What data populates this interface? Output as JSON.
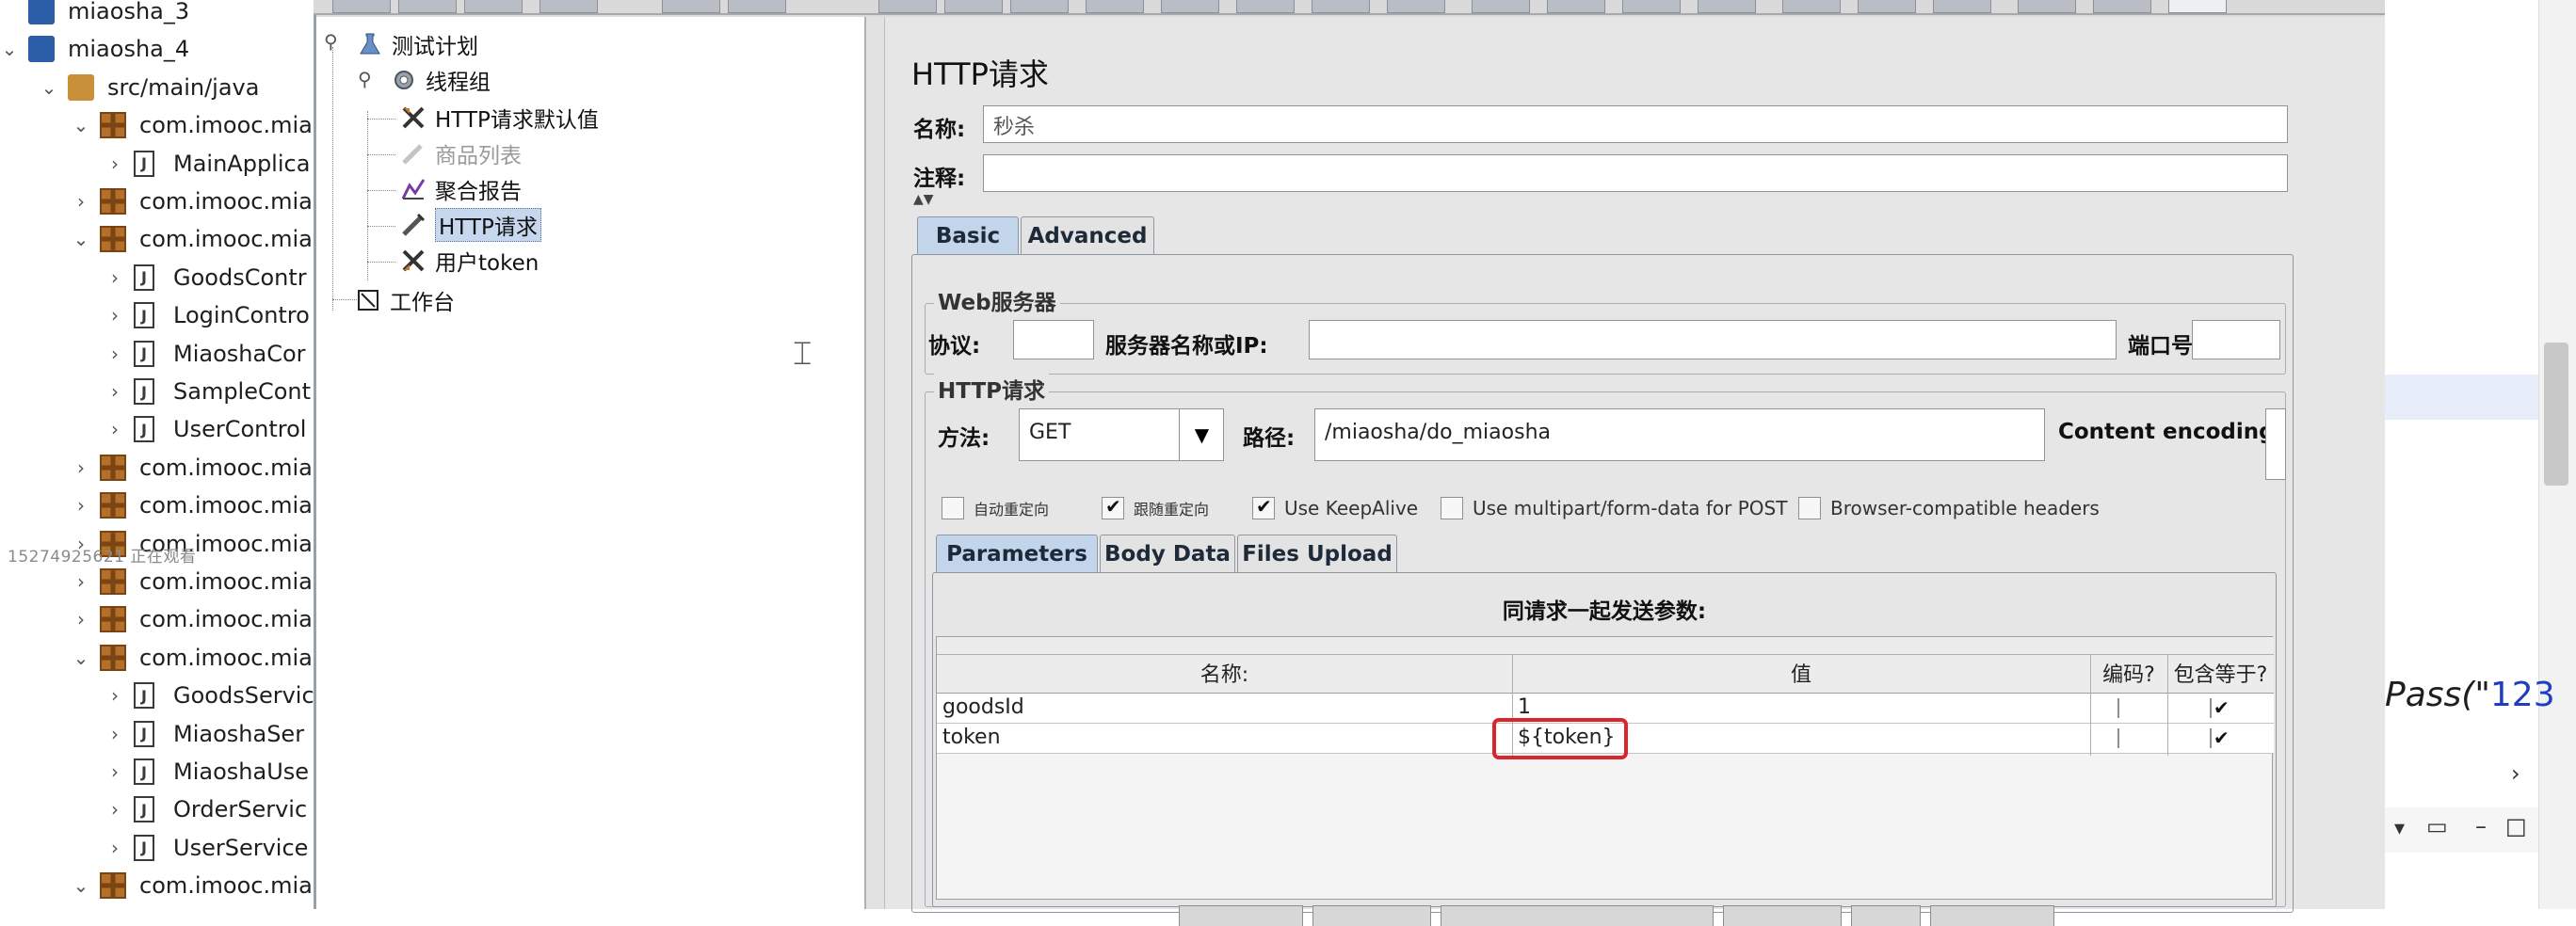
{
  "ide": {
    "tree": [
      {
        "label": "miaosha_3",
        "indent": 0,
        "icon": "project",
        "expanded": null
      },
      {
        "label": "miaosha_4",
        "indent": 0,
        "icon": "project",
        "expanded": true
      },
      {
        "label": "src/main/java",
        "indent": 1,
        "icon": "source-folder",
        "expanded": true
      },
      {
        "label": "com.imooc.mia",
        "indent": 2,
        "icon": "package",
        "expanded": true
      },
      {
        "label": "MainApplica",
        "indent": 3,
        "icon": "java",
        "expanded": false
      },
      {
        "label": "com.imooc.mia",
        "indent": 2,
        "icon": "package",
        "expanded": false
      },
      {
        "label": "com.imooc.mia",
        "indent": 2,
        "icon": "package",
        "expanded": true
      },
      {
        "label": "GoodsContr",
        "indent": 3,
        "icon": "java",
        "expanded": false
      },
      {
        "label": "LoginContro",
        "indent": 3,
        "icon": "java",
        "expanded": false
      },
      {
        "label": "MiaoshaCor",
        "indent": 3,
        "icon": "java",
        "expanded": false
      },
      {
        "label": "SampleCont",
        "indent": 3,
        "icon": "java",
        "expanded": false
      },
      {
        "label": "UserControl",
        "indent": 3,
        "icon": "java",
        "expanded": false
      },
      {
        "label": "com.imooc.mia",
        "indent": 2,
        "icon": "package",
        "expanded": false
      },
      {
        "label": "com.imooc.mia",
        "indent": 2,
        "icon": "package",
        "expanded": false
      },
      {
        "label": "com.imooc.mia",
        "indent": 2,
        "icon": "package",
        "expanded": false
      },
      {
        "label": "com.imooc.mia",
        "indent": 2,
        "icon": "package",
        "expanded": false
      },
      {
        "label": "com.imooc.mia",
        "indent": 2,
        "icon": "package",
        "expanded": false
      },
      {
        "label": "com.imooc.mia",
        "indent": 2,
        "icon": "package",
        "expanded": true
      },
      {
        "label": "GoodsServic",
        "indent": 3,
        "icon": "java",
        "expanded": false
      },
      {
        "label": "MiaoshaSer",
        "indent": 3,
        "icon": "java",
        "expanded": false
      },
      {
        "label": "MiaoshaUse",
        "indent": 3,
        "icon": "java",
        "expanded": false
      },
      {
        "label": "OrderServic",
        "indent": 3,
        "icon": "java",
        "expanded": false
      },
      {
        "label": "UserService",
        "indent": 3,
        "icon": "java",
        "expanded": false
      },
      {
        "label": "com.imooc.mia",
        "indent": 2,
        "icon": "package",
        "expanded": true
      }
    ],
    "watermark": "15274925621 正在观看"
  },
  "jmeter": {
    "tree": {
      "test_plan": "测试计划",
      "thread_group": "线程组",
      "http_defaults": "HTTP请求默认值",
      "goods_list": "商品列表",
      "aggregate_report": "聚合报告",
      "http_request": "HTTP请求",
      "user_token": "用户token",
      "workbench": "工作台"
    },
    "panel": {
      "title": "HTTP请求",
      "name_label": "名称:",
      "name_value": "秒杀",
      "comment_label": "注释:",
      "comment_value": "",
      "tabs": [
        "Basic",
        "Advanced"
      ],
      "web_server": {
        "title": "Web服务器",
        "protocol_label": "协议:",
        "server_label": "服务器名称或IP:",
        "port_label": "端口号:"
      },
      "http_section": {
        "title": "HTTP请求",
        "method_label": "方法:",
        "method_value": "GET",
        "path_label": "路径:",
        "path_value": "/miaosha/do_miaosha",
        "encoding_label": "Content encoding:"
      },
      "options": [
        {
          "label": "自动重定向",
          "checked": false
        },
        {
          "label": "跟随重定向",
          "checked": true
        },
        {
          "label": "Use KeepAlive",
          "checked": true
        },
        {
          "label": "Use multipart/form-data for POST",
          "checked": false
        },
        {
          "label": "Browser-compatible headers",
          "checked": false
        }
      ],
      "param_tabs": [
        "Parameters",
        "Body Data",
        "Files Upload"
      ],
      "params_title": "同请求一起发送参数:",
      "columns": [
        "名称:",
        "值",
        "编码?",
        "包含等于?"
      ],
      "rows": [
        {
          "name": "goodsId",
          "value": "1",
          "encode": false,
          "include_equals": true
        },
        {
          "name": "token",
          "value": "${token}",
          "encode": false,
          "include_equals": true
        }
      ]
    }
  },
  "editor": {
    "code_fragment_1": "Pass(\"",
    "code_fragment_2": "123"
  },
  "colors": {
    "highlight_box": "#d9252b",
    "selected_tab": "#c2d5ea",
    "code_string": "#1f3fc0"
  }
}
